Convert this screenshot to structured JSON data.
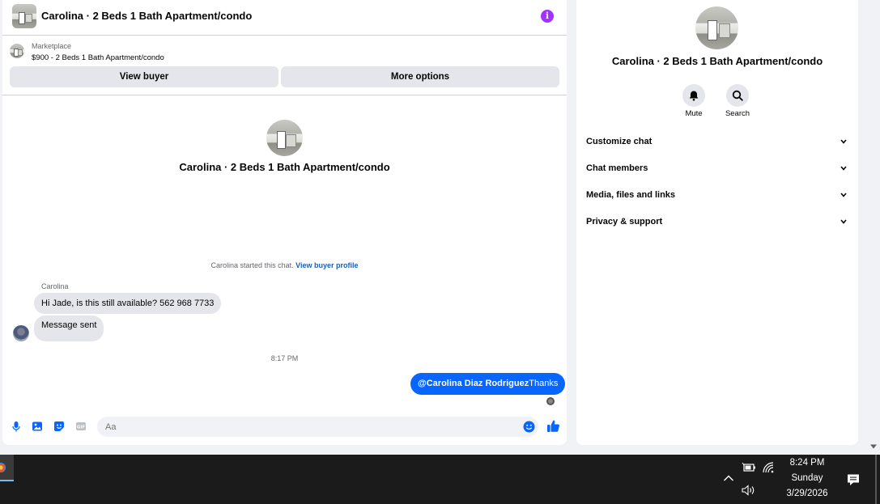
{
  "chat": {
    "header_title": "Carolina · 2 Beds 1 Bath Apartment/condo",
    "listing": {
      "source": "Marketplace",
      "price_title": "$900 - 2 Beds 1 Bath Apartment/condo",
      "view_buyer_label": "View buyer",
      "more_options_label": "More options"
    },
    "intro_title": "Carolina · 2 Beds 1 Bath Apartment/condo",
    "started_text": "Carolina started this chat.",
    "started_link": "View buyer profile",
    "sender_name": "Carolina",
    "messages": [
      {
        "text": "Hi Jade, is this still available? 562 968 7733"
      },
      {
        "text": "Message sent"
      }
    ],
    "timestamp": "8:17 PM",
    "outgoing": {
      "mention": "@Carolina Diaz Rodriguez",
      "text": "Thanks"
    },
    "composer_placeholder": "Aa",
    "composer_icons": [
      "mic-icon",
      "image-icon",
      "sticker-icon",
      "gif-icon",
      "emoji-icon",
      "like-icon"
    ],
    "accent_color": "#0866ff",
    "info_color": "#a033ff"
  },
  "info_panel": {
    "title": "Carolina · 2 Beds 1 Bath Apartment/condo",
    "actions": [
      {
        "label": "Mute",
        "icon": "bell-icon"
      },
      {
        "label": "Search",
        "icon": "search-icon"
      }
    ],
    "sections": [
      {
        "label": "Customize chat"
      },
      {
        "label": "Chat members"
      },
      {
        "label": "Media, files and links"
      },
      {
        "label": "Privacy & support"
      }
    ]
  },
  "taskbar": {
    "time": "8:24 PM",
    "day": "Sunday",
    "date": "3/29/2026",
    "tray_icons": [
      "chevron-up-icon",
      "battery-icon",
      "wifi-icon",
      "volume-icon",
      "notification-icon"
    ]
  }
}
